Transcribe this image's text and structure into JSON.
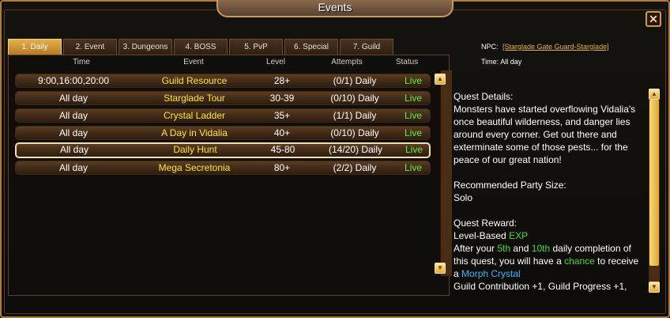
{
  "window": {
    "title": "Events",
    "close_label": "✕"
  },
  "tabs": [
    {
      "label": "1. Daily",
      "active": true
    },
    {
      "label": "2. Event"
    },
    {
      "label": "3. Dungeons"
    },
    {
      "label": "4. BOSS"
    },
    {
      "label": "5. PvP"
    },
    {
      "label": "6. Special"
    },
    {
      "label": "7. Guild"
    }
  ],
  "table": {
    "headers": {
      "time": "Time",
      "event": "Event",
      "level": "Level",
      "attempts": "Attempts",
      "status": "Status"
    },
    "rows": [
      {
        "time": "9:00,16:00,20:00",
        "event": "Guild Resource",
        "level": "28+",
        "attempts": "(0/1) Daily",
        "status": "Live"
      },
      {
        "time": "All day",
        "event": "Starglade Tour",
        "level": "30-39",
        "attempts": "(0/10) Daily",
        "status": "Live"
      },
      {
        "time": "All day",
        "event": "Crystal Ladder",
        "level": "35+",
        "attempts": "(1/1) Daily",
        "status": "Live"
      },
      {
        "time": "All day",
        "event": "A Day in Vidalia",
        "level": "40+",
        "attempts": "(0/10) Daily",
        "status": "Live"
      },
      {
        "time": "All day",
        "event": "Daily Hunt",
        "level": "45-80",
        "attempts": "(14/20) Daily",
        "status": "Live",
        "selected": true
      },
      {
        "time": "All day",
        "event": "Mega Secretonia",
        "level": "80+",
        "attempts": "(2/2) Daily",
        "status": "Live"
      }
    ]
  },
  "detail": {
    "npc_label": "NPC:",
    "npc_name": "[Starglade Gate Guard-Starglade]",
    "time_label": "Time:",
    "time_value": "All day",
    "quest_details_heading": "Quest Details:",
    "quest_details_text": "Monsters have started overflowing Vidalia's once beautiful wilderness, and danger lies around every corner. Get out there and exterminate some of those pests... for the peace of our great nation!",
    "party_heading": "Recommended Party Size:",
    "party_value": "Solo",
    "reward_heading": "Quest Reward:",
    "reward_line_prefix": "Level-Based",
    "reward_exp": "EXP",
    "reward_after": "After your",
    "reward_5th": "5th",
    "reward_and": "and",
    "reward_10th": "10th",
    "reward_daily_completion": "daily completion of this quest, you will have a",
    "reward_chance": "chance",
    "reward_to_receive": "to receive a",
    "reward_morph": "Morph Crystal",
    "reward_guild": "Guild Contribution +1, Guild Progress +1,"
  },
  "colors": {
    "accent": "#e6b04a",
    "event_name": "#ffe629",
    "status_live": "#5df23a",
    "highlight_green": "#3ddc2a",
    "highlight_cyan": "#2fb6ff"
  },
  "icons": {
    "up": "chevron-up-icon",
    "down": "chevron-down-icon",
    "close": "close-icon"
  }
}
